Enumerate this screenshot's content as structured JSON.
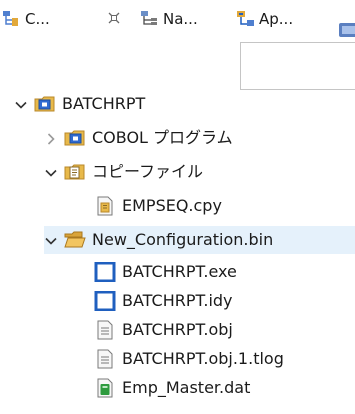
{
  "tabs": [
    {
      "label": "C...",
      "icon": "package-explorer-icon"
    },
    {
      "label": "Na...",
      "icon": "navigator-icon"
    },
    {
      "label": "Ap...",
      "icon": "application-explorer-icon"
    }
  ],
  "tree": {
    "project": {
      "label": "BATCHRPT",
      "expanded": true
    },
    "cobol_folder": {
      "label": "COBOL プログラム",
      "expanded": false
    },
    "copybook_folder": {
      "label": "コピーファイル",
      "expanded": true
    },
    "copybook_files": [
      {
        "label": "EMPSEQ.cpy"
      }
    ],
    "config_folder": {
      "label": "New_Configuration.bin",
      "expanded": true,
      "selected": true
    },
    "config_files": [
      {
        "label": "BATCHRPT.exe",
        "icon": "executable-icon"
      },
      {
        "label": "BATCHRPT.idy",
        "icon": "executable-icon"
      },
      {
        "label": "BATCHRPT.obj",
        "icon": "text-file-icon"
      },
      {
        "label": "BATCHRPT.obj.1.tlog",
        "icon": "text-file-icon"
      },
      {
        "label": "Emp_Master.dat",
        "icon": "data-file-icon"
      }
    ]
  },
  "colors": {
    "selection": "#e5f1fb",
    "folder": "#e8b94a",
    "executable": "#1f5fbf",
    "data_file": "#2e9b3e"
  }
}
